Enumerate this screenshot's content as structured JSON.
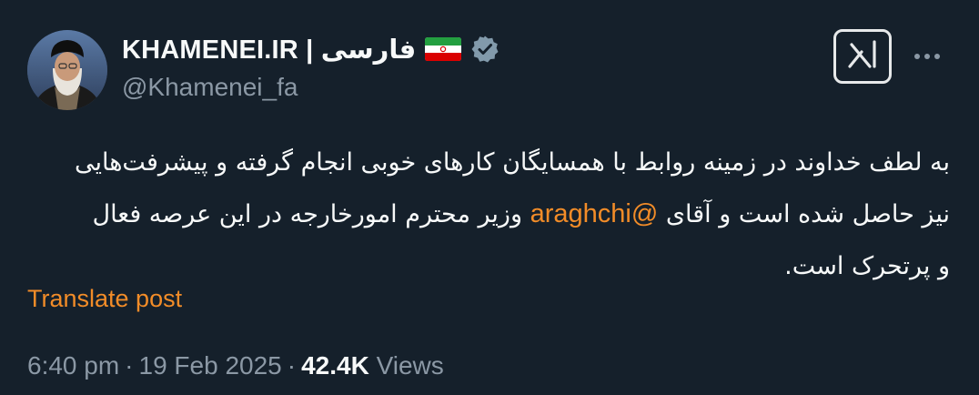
{
  "author": {
    "display_name": "KHAMENEI.IR | فارسی",
    "handle": "@Khamenei_fa",
    "flag_icon": "iran-flag-icon",
    "verified_icon": "verified-badge-icon",
    "verified_color": "#829aab"
  },
  "actions": {
    "grok_icon": "grok-icon",
    "more_icon": "more-dots-icon"
  },
  "post": {
    "line1": "به لطف خداوند در زمینه روابط با همسایگان کارهای خوبی انجام گرفته و پیشرفت‌هایی",
    "line2_before": "نیز حاصل شده است و آقای ",
    "mention": "@araghchi",
    "line2_after": " وزیر محترم امورخارجه در این عرصه فعال",
    "line3": "و پرتحرک است."
  },
  "translate_label": "Translate post",
  "meta": {
    "time": "6:40 pm",
    "separator": "·",
    "date": "19 Feb 2025",
    "views_count": "42.4K",
    "views_label": "Views"
  },
  "colors": {
    "background": "#15202b",
    "accent": "#f28c28",
    "muted": "#8b98a5",
    "text": "#f7f9f9"
  }
}
